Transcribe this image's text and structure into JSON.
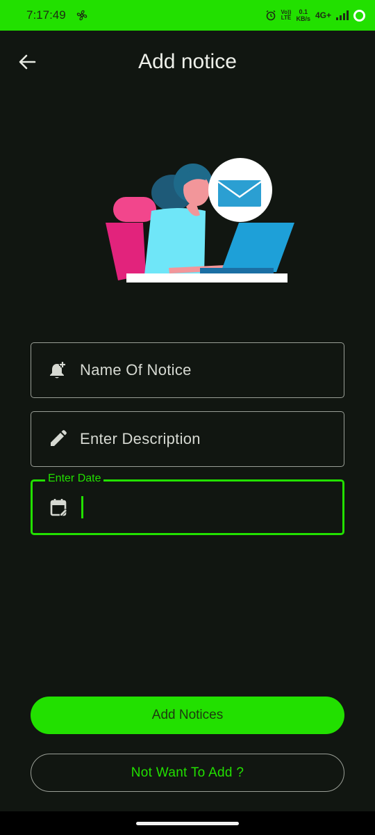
{
  "status_bar": {
    "time": "7:17:49",
    "volte_top": "Vo))",
    "volte_bottom": "LTE",
    "speed_value": "0.1",
    "speed_unit": "KB/s",
    "network": "4G+"
  },
  "header": {
    "title": "Add notice",
    "back_icon": "arrow-left-icon"
  },
  "form": {
    "name_field": {
      "placeholder": "Name Of Notice",
      "icon": "notification-add-icon",
      "value": ""
    },
    "description_field": {
      "placeholder": "Enter Description",
      "icon": "pencil-icon",
      "value": ""
    },
    "date_field": {
      "label": "Enter Date",
      "icon": "calendar-edit-icon",
      "value": "",
      "focused": true
    }
  },
  "actions": {
    "primary_label": "Add Notices",
    "secondary_label": "Not Want To Add ?"
  },
  "colors": {
    "accent": "#22e000",
    "background": "#111611",
    "text": "#e8ebe3",
    "outline": "#9a9f97"
  }
}
